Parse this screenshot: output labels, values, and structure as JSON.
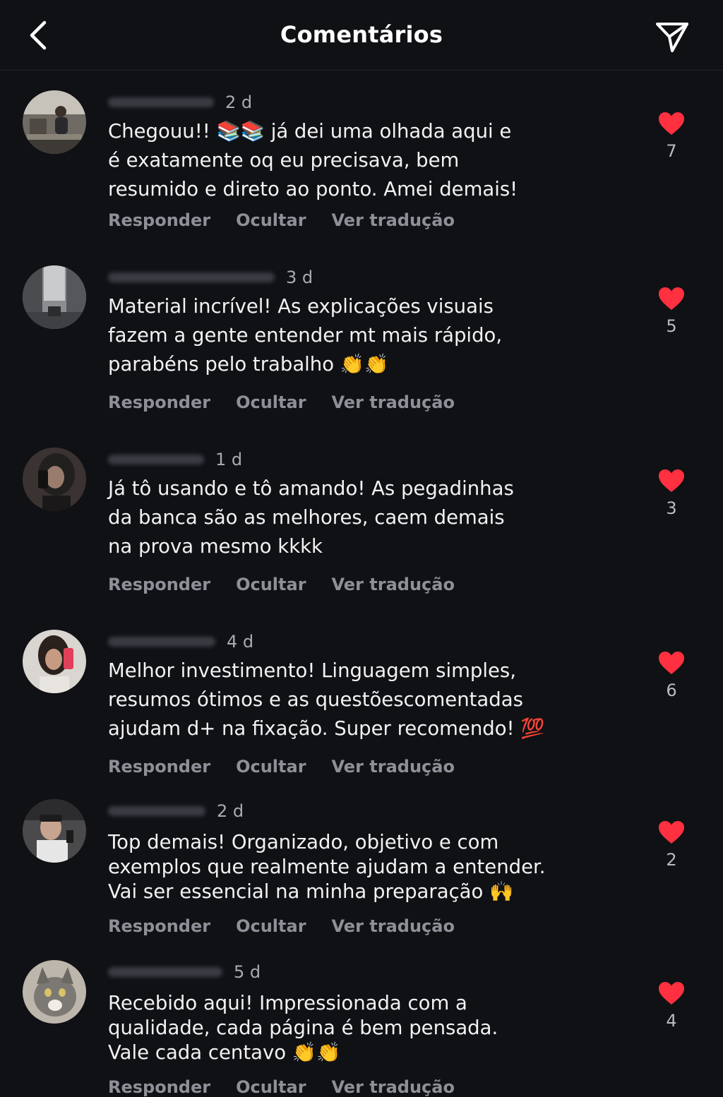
{
  "header": {
    "title": "Comentários"
  },
  "actions": {
    "reply": "Responder",
    "hide": "Ocultar",
    "translate": "Ver tradução"
  },
  "colors": {
    "background": "#101115",
    "heart": "#ff3040",
    "muted_text": "#8e9098"
  },
  "comments": [
    {
      "time": "2 d",
      "text": "Chegouu!! 📚📚 já dei uma olhada aqui e\né exatamente oq eu precisava, bem\nresumido e direto ao ponto. Amei demais!",
      "likes": "7"
    },
    {
      "time": "3 d",
      "text": "Material incrível! As explicações visuais\nfazem a gente entender mt mais rápido,\nparabéns pelo trabalho 👏👏",
      "likes": "5"
    },
    {
      "time": "1 d",
      "text": "Já tô usando e tô amando! As pegadinhas\nda banca são as melhores, caem demais\nna prova mesmo kkkk",
      "likes": "3"
    },
    {
      "time": "4 d",
      "text": "Melhor investimento! Linguagem simples,\nresumos ótimos e as questõescomentadas\najudam d+ na fixação. Super recomendo! 💯",
      "likes": "6"
    },
    {
      "time": "2 d",
      "text": "Top demais! Organizado, objetivo e com\nexemplos que realmente ajudam a entender.\nVai ser essencial na minha preparação 🙌",
      "likes": "2"
    },
    {
      "time": "5 d",
      "text": "Recebido aqui! Impressionada com a\nqualidade, cada página é bem pensada.\nVale cada centavo 👏👏",
      "likes": "4"
    }
  ]
}
